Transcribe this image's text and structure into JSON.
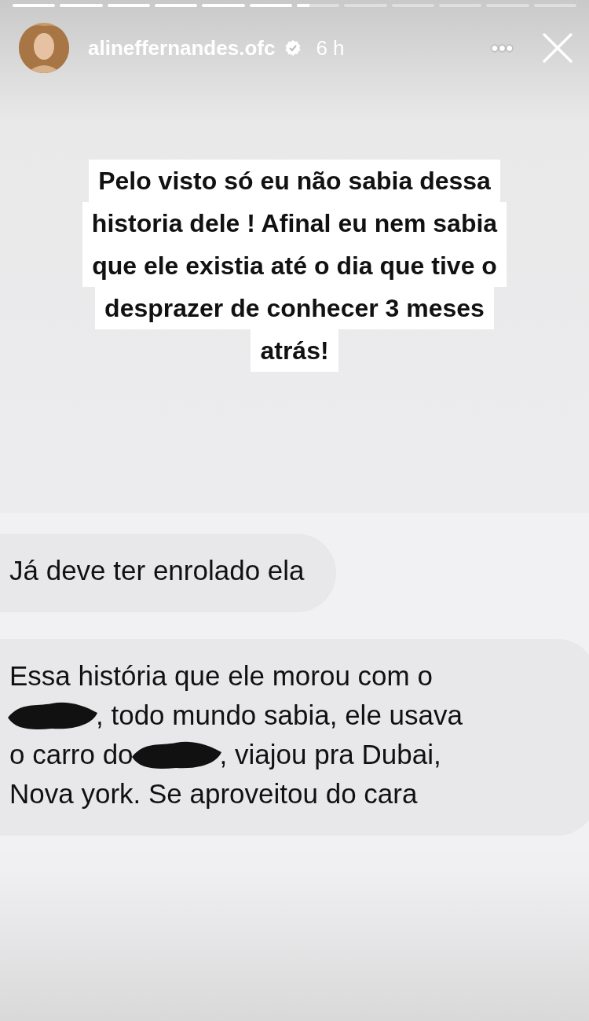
{
  "progress": [
    {
      "level": 1
    },
    {
      "level": 1
    },
    {
      "level": 1
    },
    {
      "level": 1
    },
    {
      "level": 1
    },
    {
      "level": 1
    },
    {
      "level": 0.3
    },
    {
      "level": 0
    },
    {
      "level": 0
    },
    {
      "level": 0
    },
    {
      "level": 0
    },
    {
      "level": 0
    }
  ],
  "header": {
    "username": "alineffernandes.ofc",
    "verified": true,
    "time": "6 h",
    "more": "•••"
  },
  "caption": [
    "Pelo visto só eu não sabia dessa",
    "historia dele ! Afinal eu nem sabia",
    "que ele existia até o dia que tive o",
    "desprazer de conhecer 3 meses",
    "atrás!"
  ],
  "messages": [
    {
      "lines": [
        [
          {
            "kind": "text",
            "text": "Já deve ter enrolado ela"
          }
        ]
      ]
    },
    {
      "lines": [
        [
          {
            "kind": "text",
            "text": "Essa história que ele morou com o"
          }
        ],
        [
          {
            "kind": "redacted"
          },
          {
            "kind": "text",
            "text": ", todo mundo sabia, ele usava"
          }
        ],
        [
          {
            "kind": "text",
            "text": "o carro do"
          },
          {
            "kind": "redacted"
          },
          {
            "kind": "text",
            "text": ", viajou pra Dubai,"
          }
        ],
        [
          {
            "kind": "text",
            "text": "Nova york. Se aproveitou do cara"
          }
        ]
      ]
    }
  ]
}
